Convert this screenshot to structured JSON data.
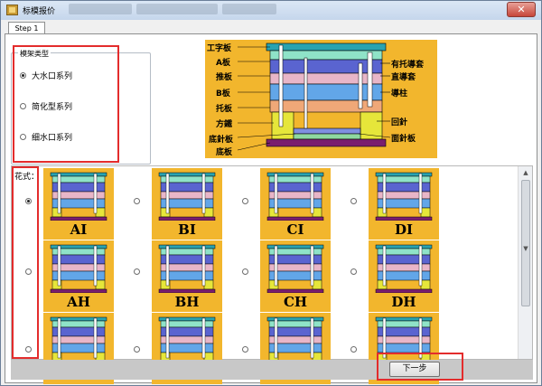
{
  "window": {
    "title": "标模报价",
    "close_glyph": "✕"
  },
  "tabs": [
    {
      "label": "Step 1"
    }
  ],
  "frame_type": {
    "title": "模架类型",
    "options": [
      {
        "label": "大水口系列",
        "checked": true
      },
      {
        "label": "简化型系列",
        "checked": false
      },
      {
        "label": "细水口系列",
        "checked": false
      }
    ]
  },
  "diagram": {
    "labels_left": [
      "工字板",
      "A板",
      "推板",
      "B板",
      "托板",
      "方鐵",
      "底針板",
      "底板"
    ],
    "labels_right": [
      "有托導套",
      "直導套",
      "導柱",
      "回針",
      "面針板"
    ]
  },
  "styles": {
    "title": "花式：",
    "items": [
      {
        "code": "AI",
        "checked": true
      },
      {
        "code": "BI",
        "checked": false
      },
      {
        "code": "CI",
        "checked": false
      },
      {
        "code": "DI",
        "checked": false
      },
      {
        "code": "AH",
        "checked": false
      },
      {
        "code": "BH",
        "checked": false
      },
      {
        "code": "CH",
        "checked": false
      },
      {
        "code": "DH",
        "checked": false
      },
      {
        "code": "",
        "checked": false
      },
      {
        "code": "",
        "checked": false
      },
      {
        "code": "",
        "checked": false
      },
      {
        "code": "",
        "checked": false
      }
    ]
  },
  "buttons": {
    "next": "下一步"
  },
  "colors": {
    "mold_bg": "#f2b62d",
    "highlight": "#e32c2c"
  }
}
